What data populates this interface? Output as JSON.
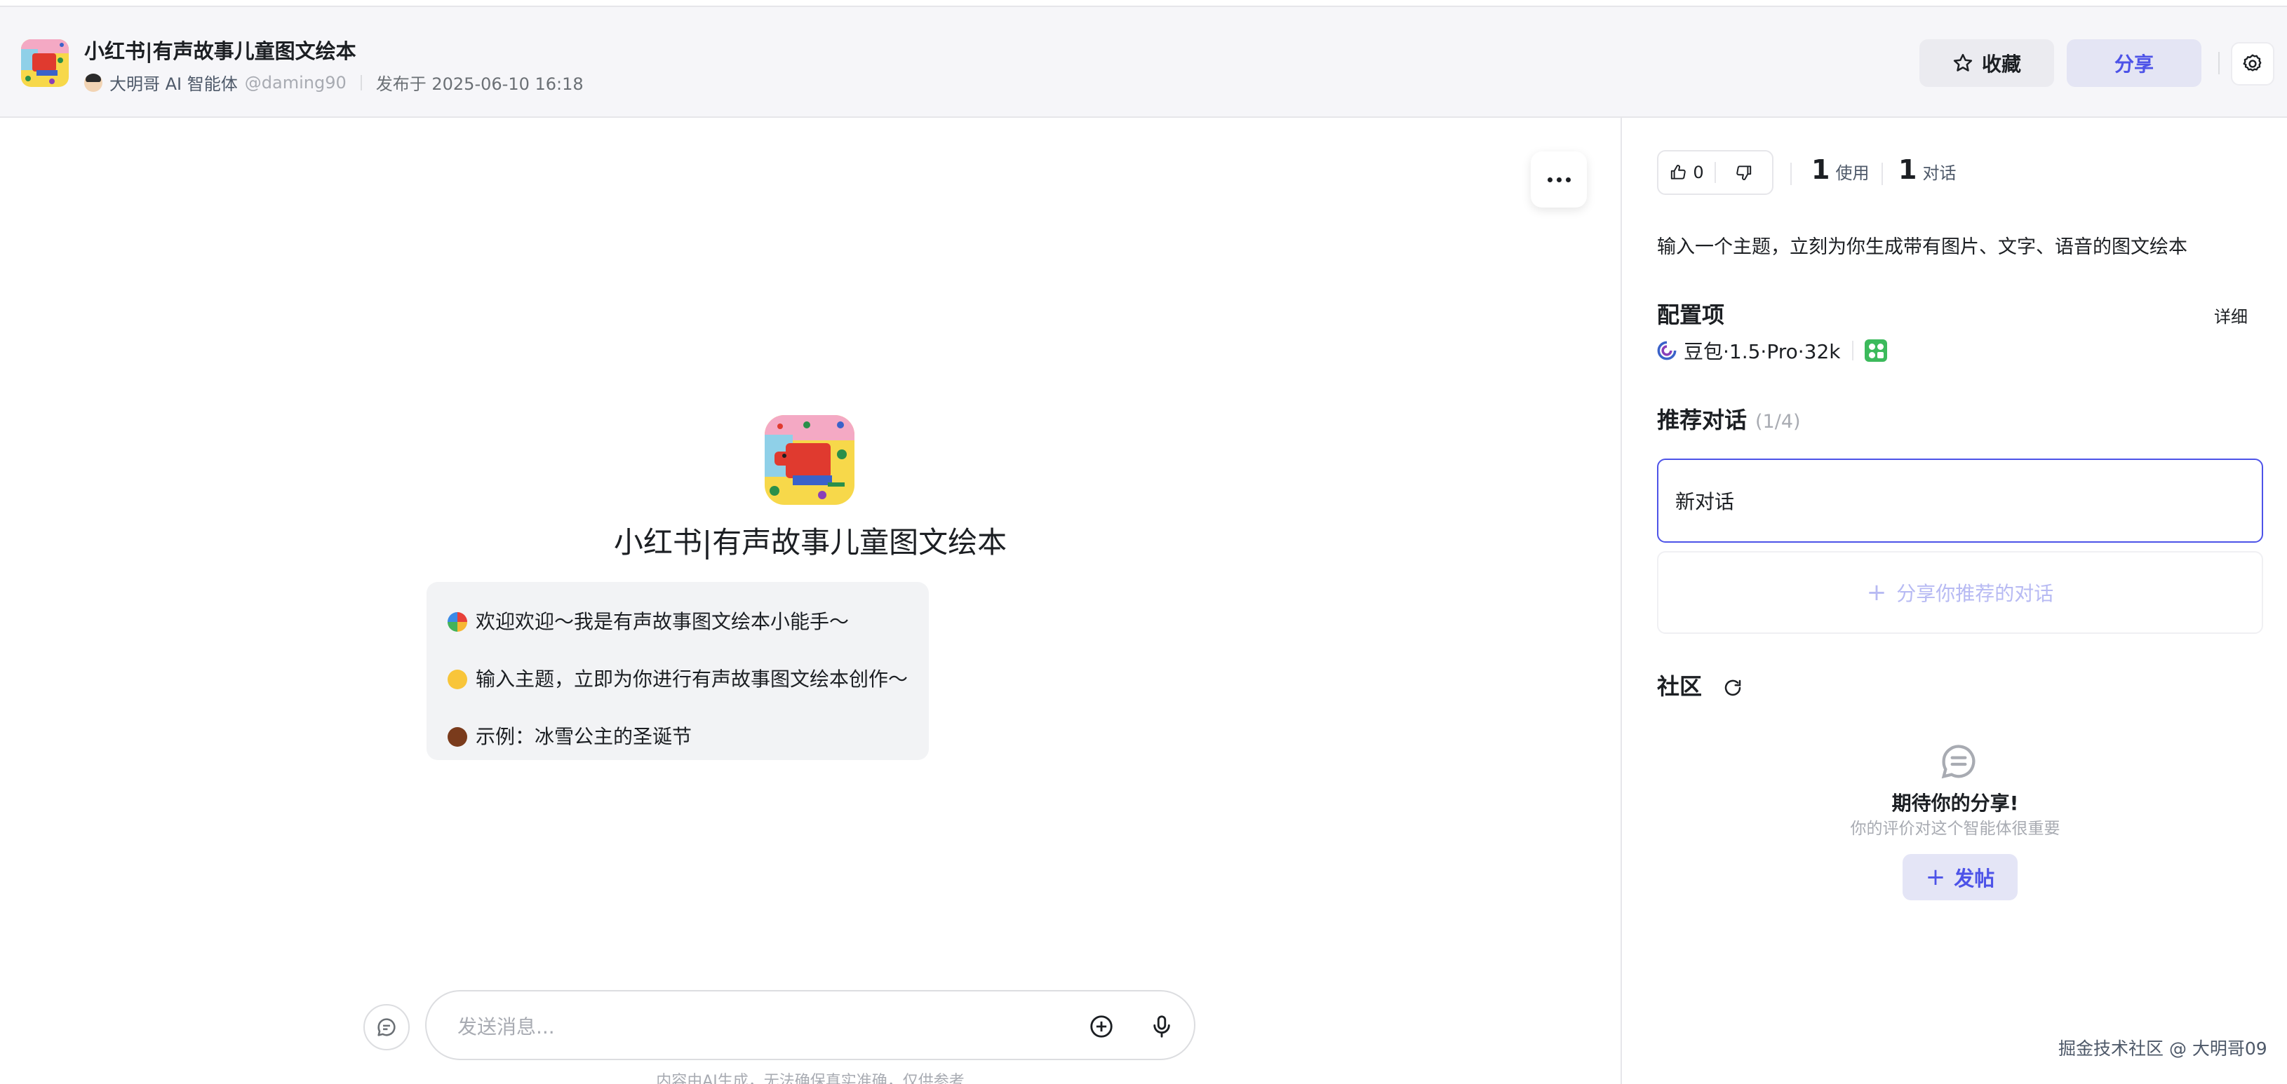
{
  "header": {
    "title": "小红书|有声故事儿童图文绘本",
    "author": "大明哥 AI 智能体",
    "handle": "@daming90",
    "published": "发布于 2025-06-10 16:18",
    "favorite_label": "收藏",
    "share_label": "分享",
    "icons": [
      "star-icon",
      "gear-icon"
    ]
  },
  "main": {
    "bot_name": "小红书|有声故事儿童图文绘本",
    "welcome_lines": [
      {
        "text": "欢迎欢迎～我是有声故事图文绘本小能手～",
        "emoji": "rainbow-emoji"
      },
      {
        "text": "输入主题，立即为你进行有声故事图文绘本创作～",
        "emoji": "hugging-face-emoji"
      },
      {
        "text": "示例：冰雪公主的圣诞节",
        "emoji": "chestnut-emoji"
      }
    ],
    "input_placeholder": "发送消息...",
    "disclaimer": "内容由AI生成，无法确保真实准确，仅供参考"
  },
  "sidebar": {
    "likes": "0",
    "usage_count": "1",
    "usage_label": "使用",
    "chat_count": "1",
    "chat_label": "对话",
    "description": "输入一个主题，立刻为你生成带有图片、文字、语音的图文绘本",
    "config_title": "配置项",
    "detail_label": "详细",
    "model_name": "豆包·1.5·Pro·32k",
    "recommend_title": "推荐对话",
    "recommend_count": "(1/4)",
    "new_chat_label": "新对话",
    "share_recommend_label": "分享你推荐的对话",
    "community_title": "社区",
    "empty_title": "期待你的分享!",
    "empty_subtitle": "你的评价对这个智能体很重要",
    "post_label": "发帖"
  },
  "watermark": "掘金技术社区 @ 大明哥09",
  "colors": {
    "accent": "#4d53e8",
    "header_bg": "#f6f6f9",
    "bubble_bg": "#f2f3f5"
  }
}
